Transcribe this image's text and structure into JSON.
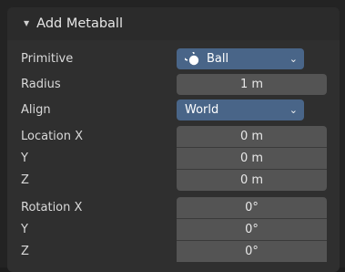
{
  "panel": {
    "title": "Add Metaball",
    "collapse_glyph": "▼"
  },
  "primitive": {
    "label": "Primitive",
    "value": "Ball",
    "icon": "metaball-ball-icon"
  },
  "radius": {
    "label": "Radius",
    "value": "1 m"
  },
  "align": {
    "label": "Align",
    "value": "World"
  },
  "location": {
    "label_x": "Location X",
    "label_y": "Y",
    "label_z": "Z",
    "x": "0 m",
    "y": "0 m",
    "z": "0 m"
  },
  "rotation": {
    "label_x": "Rotation X",
    "label_y": "Y",
    "label_z": "Z",
    "x": "0°",
    "y": "0°",
    "z": "0°"
  },
  "chevron_glyph": "⌄",
  "colors": {
    "panel_bg": "#2f2f2f",
    "field_bg": "#545454",
    "dropdown_bg": "#496588",
    "text": "#d9d9d9"
  }
}
